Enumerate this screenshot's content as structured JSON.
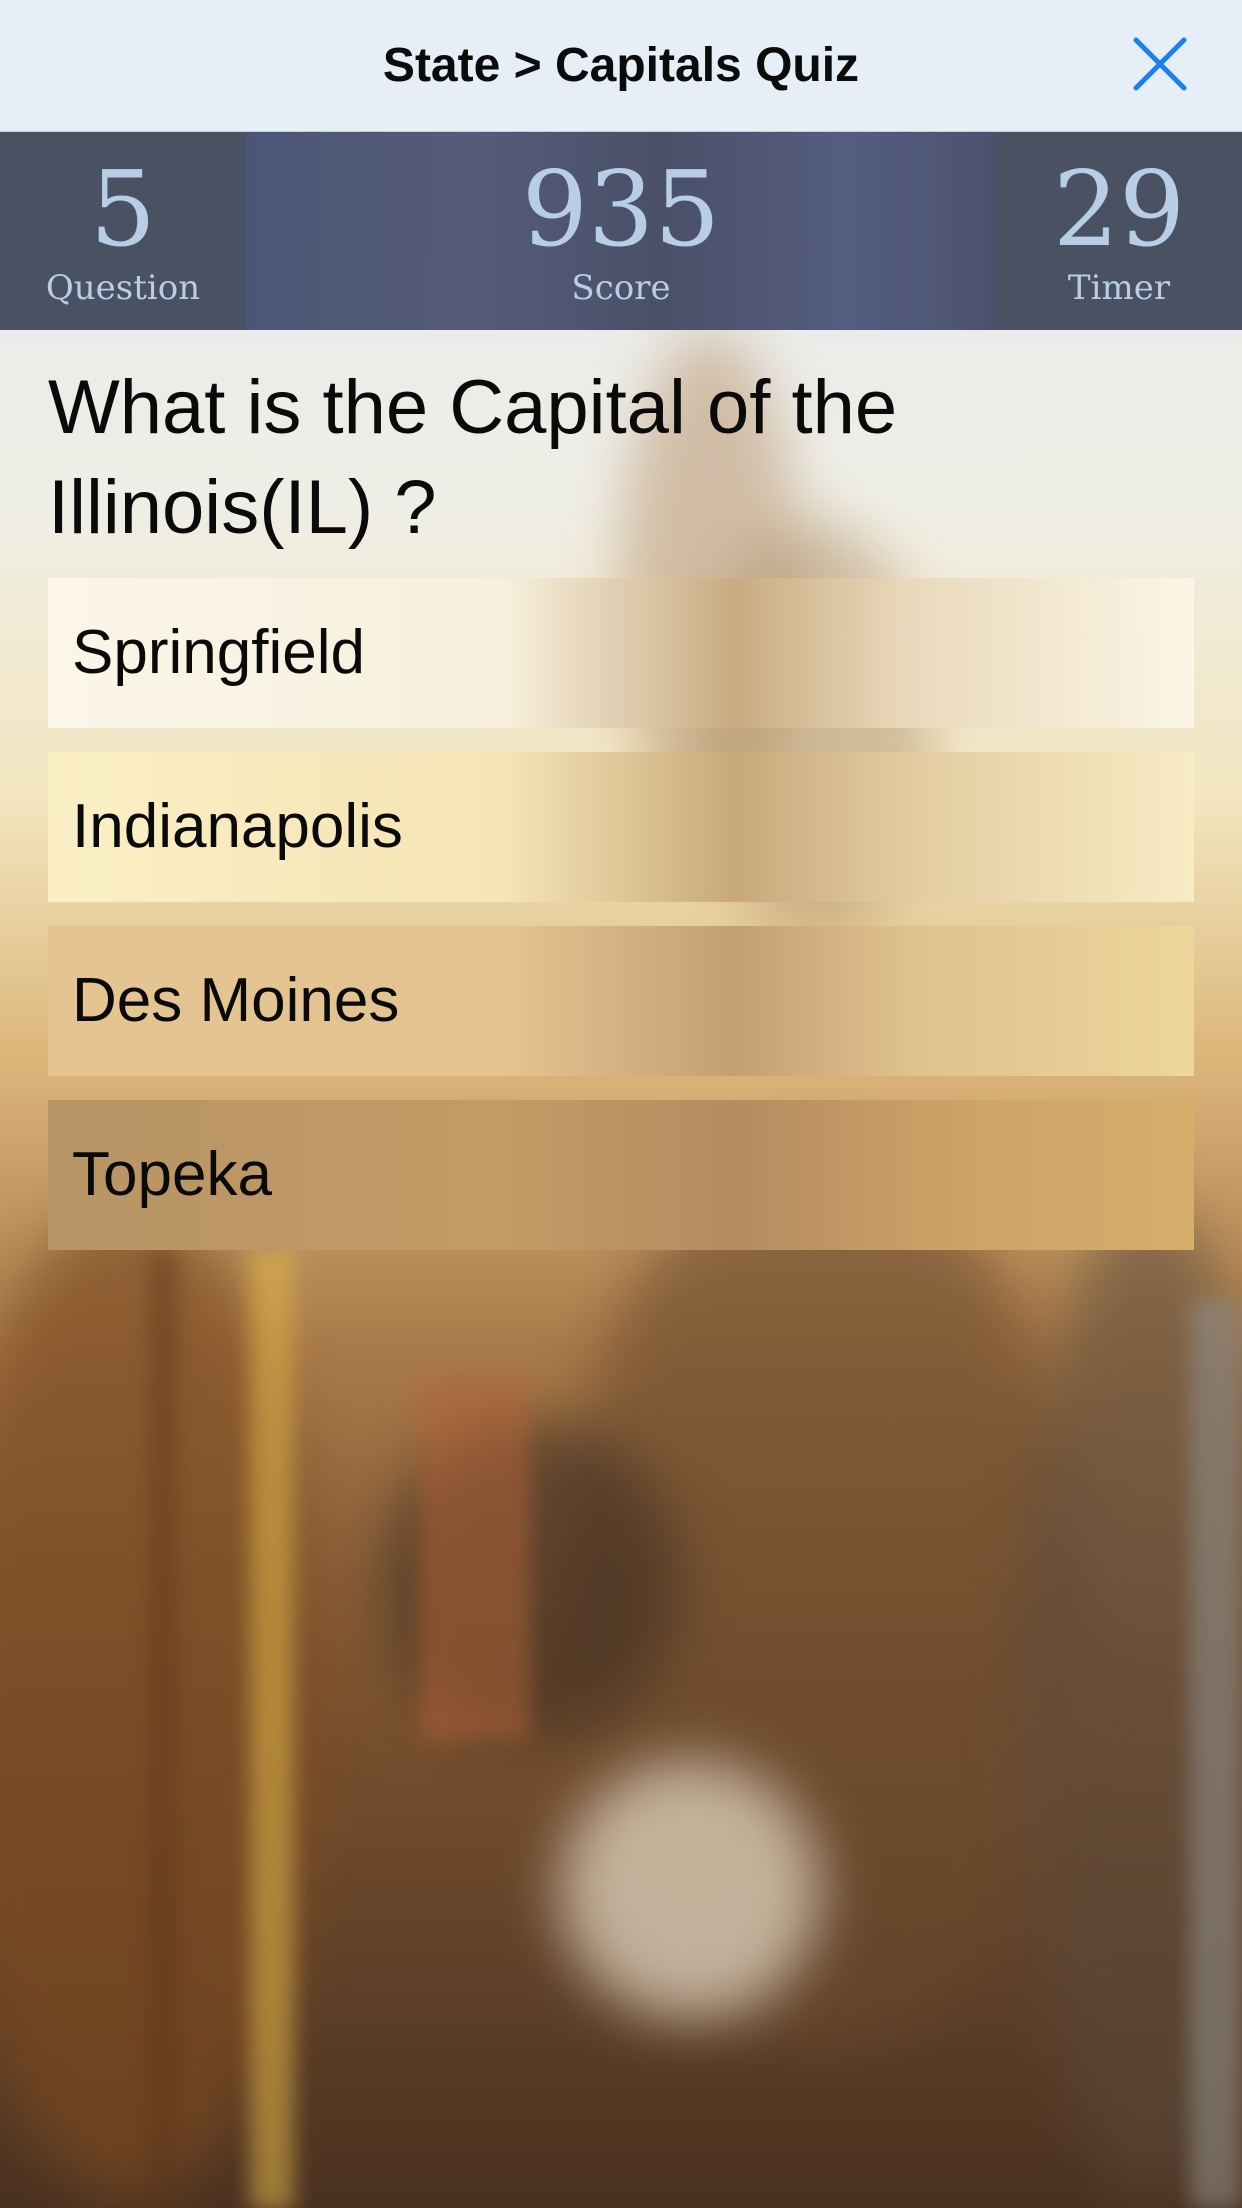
{
  "nav": {
    "title": "State > Capitals Quiz",
    "close_icon": "close-icon",
    "accent": "#1a7ff0"
  },
  "stats": {
    "question": {
      "value": "5",
      "label": "Question"
    },
    "score": {
      "value": "935",
      "label": "Score"
    },
    "timer": {
      "value": "29",
      "label": "Timer"
    }
  },
  "quiz": {
    "question": "What is the Capital of the Illinois(IL) ?",
    "answers": [
      "Springfield",
      "Indianapolis",
      "Des Moines",
      "Topeka"
    ]
  }
}
